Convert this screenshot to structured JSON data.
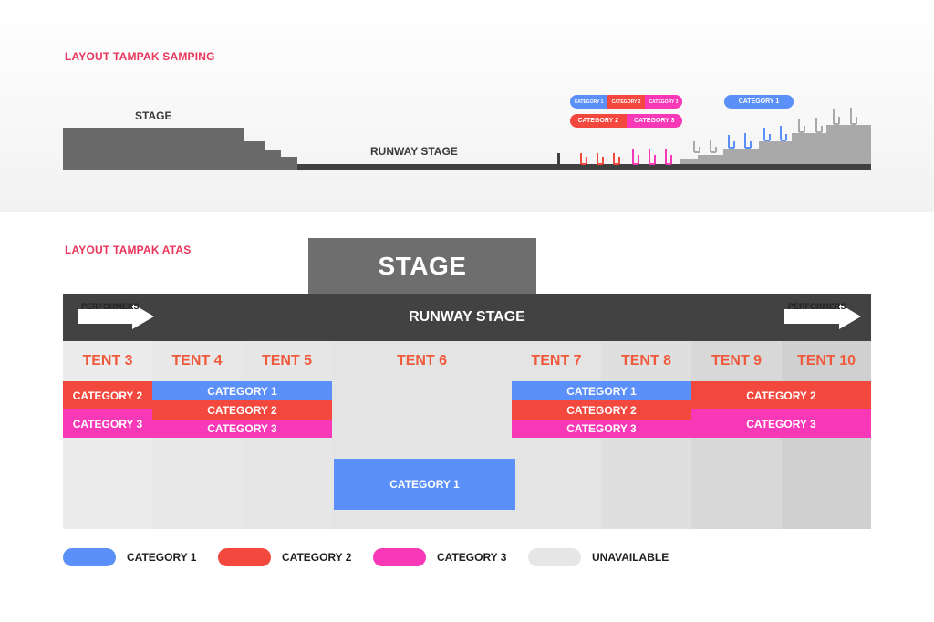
{
  "colors": {
    "category_1": "#5b8ff9",
    "category_2": "#f3483e",
    "category_3": "#f739b8",
    "unavailable": "#e6e6e6",
    "title_accent": "#e8365a",
    "tent_label": "#ef5a3c"
  },
  "side_view": {
    "title": "LAYOUT TAMPAK SAMPING",
    "stage_label": "STAGE",
    "runway_label": "RUNWAY STAGE",
    "pills_row_a": [
      "CATEGORY 1",
      "CATEGORY 2",
      "CATEGORY 3"
    ],
    "pills_row_b": [
      "CATEGORY 2",
      "CATEGORY 3"
    ],
    "pill_right": "CATEGORY 1"
  },
  "top_view": {
    "title": "LAYOUT TAMPAK ATAS",
    "stage_label": "STAGE",
    "runway_label": "RUNWAY STAGE",
    "performers_left": "PERFORMERS",
    "performers_right": "PERFORMERS",
    "tents": [
      {
        "name": "TENT 3"
      },
      {
        "name": "TENT 4"
      },
      {
        "name": "TENT 5"
      },
      {
        "name": "TENT 6"
      },
      {
        "name": "TENT 7"
      },
      {
        "name": "TENT 8"
      },
      {
        "name": "TENT 9"
      },
      {
        "name": "TENT 10"
      }
    ],
    "tent3_bands": [
      "CATEGORY 2",
      "CATEGORY 3"
    ],
    "tent45_bands": [
      "CATEGORY 1",
      "CATEGORY 2",
      "CATEGORY 3"
    ],
    "tent6_band": "CATEGORY 1",
    "tent78_bands": [
      "CATEGORY 1",
      "CATEGORY 2",
      "CATEGORY 3"
    ],
    "tent910_bands": [
      "CATEGORY 2",
      "CATEGORY 3"
    ]
  },
  "legend": [
    {
      "label": "CATEGORY 1",
      "color": "#5b8ff9"
    },
    {
      "label": "CATEGORY 2",
      "color": "#f3483e"
    },
    {
      "label": "CATEGORY 3",
      "color": "#f739b8"
    },
    {
      "label": "UNAVAILABLE",
      "color": "#e6e6e6"
    }
  ]
}
